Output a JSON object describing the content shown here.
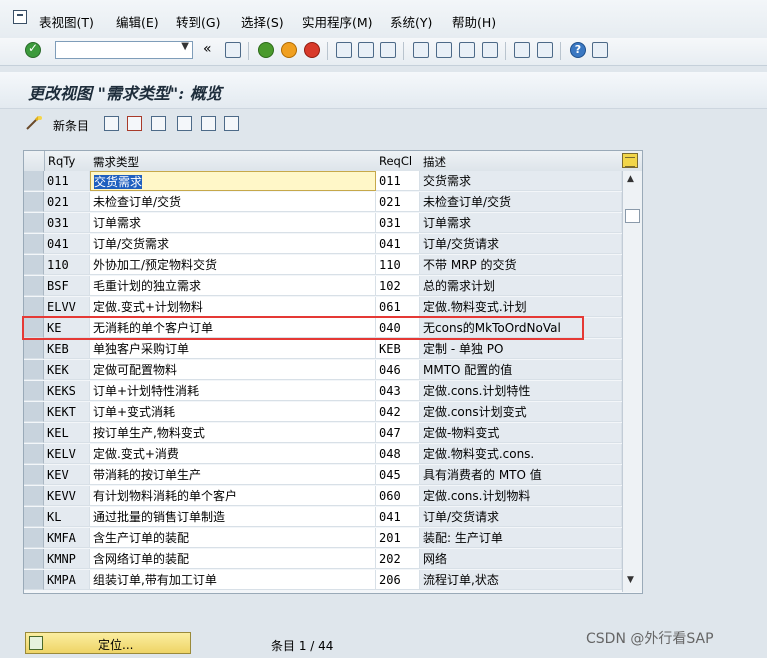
{
  "menu": [
    "表视图(T)",
    "编辑(E)",
    "转到(G)",
    "选择(S)",
    "实用程序(M)",
    "系统(Y)",
    "帮助(H)"
  ],
  "toolbar": {
    "nav_back": "«"
  },
  "page_title": "更改视图 \"需求类型\": 概览",
  "app_toolbar": {
    "new_entries": "新条目"
  },
  "table": {
    "headers": [
      "RqTy",
      "需求类型",
      "ReqCl",
      "描述"
    ],
    "rows": [
      {
        "code": "011",
        "name": "交货需求",
        "reqcl": "011",
        "desc": "交货需求"
      },
      {
        "code": "021",
        "name": "未检查订单/交货",
        "reqcl": "021",
        "desc": "未检查订单/交货"
      },
      {
        "code": "031",
        "name": "订单需求",
        "reqcl": "031",
        "desc": "订单需求"
      },
      {
        "code": "041",
        "name": "订单/交货需求",
        "reqcl": "041",
        "desc": "订单/交货请求"
      },
      {
        "code": "110",
        "name": "外协加工/预定物料交货",
        "reqcl": "110",
        "desc": "不带 MRP 的交货"
      },
      {
        "code": "BSF",
        "name": "毛重计划的独立需求",
        "reqcl": "102",
        "desc": "总的需求计划"
      },
      {
        "code": "ELVV",
        "name": "定做.变式+计划物料",
        "reqcl": "061",
        "desc": "定做.物料变式.计划"
      },
      {
        "code": "KE",
        "name": "无消耗的单个客户订单",
        "reqcl": "040",
        "desc": "无cons的MkToOrdNoVal"
      },
      {
        "code": "KEB",
        "name": "单独客户采购订单",
        "reqcl": "KEB",
        "desc": "定制 - 单独 PO"
      },
      {
        "code": "KEK",
        "name": "定做可配置物料",
        "reqcl": "046",
        "desc": "MMTO 配置的值"
      },
      {
        "code": "KEKS",
        "name": "订单+计划特性消耗",
        "reqcl": "043",
        "desc": "定做.cons.计划特性"
      },
      {
        "code": "KEKT",
        "name": "订单+变式消耗",
        "reqcl": "042",
        "desc": "定做.cons计划变式"
      },
      {
        "code": "KEL",
        "name": "按订单生产,物料变式",
        "reqcl": "047",
        "desc": "定做-物料变式"
      },
      {
        "code": "KELV",
        "name": "定做.变式+消费",
        "reqcl": "048",
        "desc": "定做.物料变式.cons."
      },
      {
        "code": "KEV",
        "name": "带消耗的按订单生产",
        "reqcl": "045",
        "desc": "具有消费者的 MTO 值"
      },
      {
        "code": "KEVV",
        "name": "有计划物料消耗的单个客户",
        "reqcl": "060",
        "desc": "定做.cons.计划物料"
      },
      {
        "code": "KL",
        "name": "通过批量的销售订单制造",
        "reqcl": "041",
        "desc": "订单/交货请求"
      },
      {
        "code": "KMFA",
        "name": "含生产订单的装配",
        "reqcl": "201",
        "desc": "装配: 生产订单"
      },
      {
        "code": "KMNP",
        "name": "含网络订单的装配",
        "reqcl": "202",
        "desc": "网络"
      },
      {
        "code": "KMPA",
        "name": "组装订单,带有加工订单",
        "reqcl": "206",
        "desc": "流程订单,状态"
      }
    ]
  },
  "footer": {
    "position_button": "定位...",
    "entry_count": "条目 1 / 44"
  },
  "watermark": "CSDN @外行看SAP"
}
